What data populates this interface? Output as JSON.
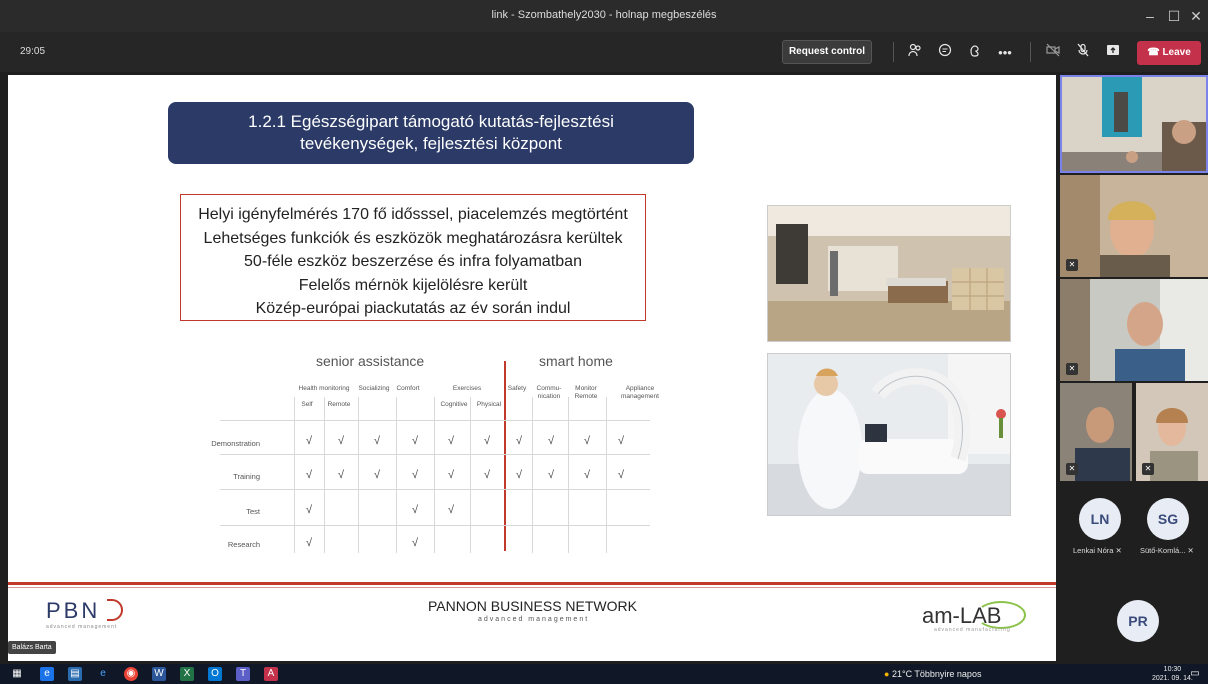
{
  "window": {
    "title": "link - Szombathely2030 - holnap megbeszélés",
    "minimize": "–",
    "maximize": "☐",
    "close": "✕"
  },
  "toolbar": {
    "timer": "29:05",
    "request_control": "Request control",
    "leave": "Leave",
    "icons": [
      "people-icon",
      "chat-icon",
      "reactions-icon",
      "more-icon",
      "camera-off-icon",
      "mic-off-icon",
      "share-icon"
    ]
  },
  "slide": {
    "title_line1": "1.2.1 Egészségipart támogató kutatás-fejlesztési",
    "title_line2": "tevékenységek, fejlesztési központ",
    "bullets": [
      "Helyi igényfelmérés 170 fő idősssel, piacelemzés megtörtént",
      "Lehetséges funkciók és eszközök meghatározásra kerültek",
      "50-féle eszköz beszerzése és infra folyamatban",
      "Felelős mérnök kijelölésre került",
      "Közép-európai piackutatás az év során indul"
    ],
    "matrix": {
      "group1": "senior assistance",
      "group2": "smart home",
      "top_headers": [
        "Health monitoring",
        "Socializing",
        "Comfort",
        "Exercises",
        "Safety",
        "Commu-nication",
        "Monitor Remote",
        "Appliance management"
      ],
      "sub_headers": [
        "Self",
        "Remote",
        "Cognitive",
        "Physical"
      ],
      "rows": [
        "Demonstration",
        "Training",
        "Test",
        "Research"
      ],
      "check": "√"
    },
    "footer": {
      "pbn": "PBN",
      "pbn_sub": "advanced management",
      "pannon": "PANNON BUSINESS NETWORK",
      "pannon_sub": "advanced management",
      "amlab": "am-LAB",
      "amlab_sub": "advanced manufacturing"
    }
  },
  "presenter": "Balázs Barta",
  "participants": {
    "ln_initials": "LN",
    "ln_name": "Lenkai Nóra",
    "sg_initials": "SG",
    "sg_name": "Sütő-Komlá...",
    "pr_initials": "PR"
  },
  "taskbar": {
    "weather": "21°C  Többnyire napos",
    "time": "10:30",
    "date": "2021. 09. 14."
  }
}
